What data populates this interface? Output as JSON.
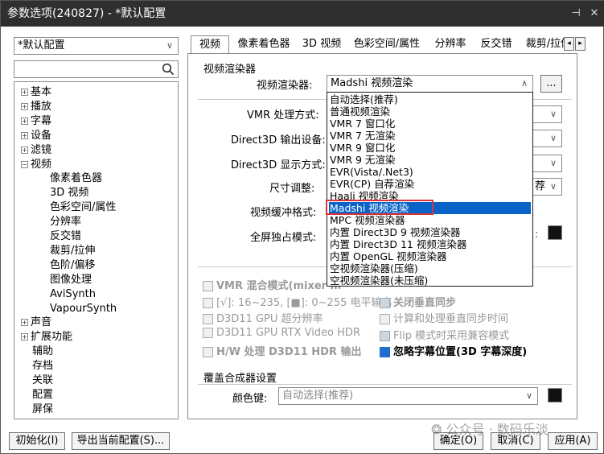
{
  "window": {
    "title": "参数选项(240827) - *默认配置",
    "pin_glyph": "⊣",
    "close_glyph": "✕"
  },
  "profile": {
    "value": "*默认配置"
  },
  "tree": {
    "items": [
      {
        "label": "基本",
        "expander": "+"
      },
      {
        "label": "播放",
        "expander": "+"
      },
      {
        "label": "字幕",
        "expander": "+"
      },
      {
        "label": "设备",
        "expander": "+"
      },
      {
        "label": "滤镜",
        "expander": "+"
      },
      {
        "label": "视频",
        "expander": "−"
      },
      {
        "label": "像素着色器"
      },
      {
        "label": "3D 视频"
      },
      {
        "label": "色彩空间/属性"
      },
      {
        "label": "分辨率"
      },
      {
        "label": "反交错"
      },
      {
        "label": "裁剪/拉伸"
      },
      {
        "label": "色阶/偏移"
      },
      {
        "label": "图像处理"
      },
      {
        "label": "AviSynth"
      },
      {
        "label": "VapourSynth"
      },
      {
        "label": "声音",
        "expander": "+"
      },
      {
        "label": "扩展功能",
        "expander": "+"
      },
      {
        "label": "辅助"
      },
      {
        "label": "存档"
      },
      {
        "label": "关联"
      },
      {
        "label": "配置"
      },
      {
        "label": "屏保"
      }
    ]
  },
  "tabs": [
    "视频",
    "像素着色器",
    "3D 视频",
    "色彩空间/属性",
    "分辨率",
    "反交错",
    "裁剪/拉伸"
  ],
  "tab_scroll": {
    "left": "◂",
    "right": "▸"
  },
  "renderer_group": {
    "title": "视频渲染器",
    "renderer_label": "视频渲染器:",
    "renderer_value": "Madshi 视频渲染",
    "more_button": "...",
    "vmr_mode_label": "VMR 处理方式:",
    "d3d_device_label": "Direct3D 输出设备:",
    "d3d_display_label": "Direct3D 显示方式:",
    "resize_label": "尺寸调整:",
    "resize_value_fragment": "荐",
    "buffer_label": "视频缓冲格式:",
    "fullscreen_label": "全屏独占模式:"
  },
  "dropdown": {
    "options": [
      "自动选择(推荐)",
      "普通视频渲染",
      "VMR 7 窗口化",
      "VMR 7 无渲染",
      "VMR 9 窗口化",
      "VMR 9 无渲染",
      "EVR(Vista/.Net3)",
      "EVR(CP) 自荐渲染",
      "Haali 视频渲染",
      "Madshi 视频渲染",
      "MPC 视频渲染器",
      "内置 Direct3D 9 视频渲染器",
      "内置 Direct3D 11 视频渲染器",
      "内置 OpenGL 视频渲染器",
      "空视频渲染器(压缩)",
      "空视频渲染器(未压缩)"
    ],
    "selected_index": 9
  },
  "options": {
    "vmr_mixer": "VMR 混合模式(mixer m",
    "levels": "[√]:  16~235, [■]:  0~255 电平输出",
    "d3d11_sr": "D3D11 GPU 超分辨率",
    "d3d11_hdr": "D3D11 GPU RTX Video HDR",
    "hw_hdr": "H/W 处理 D3D11 HDR 输出",
    "close_vsync": "关闭垂直同步",
    "compute_vsync": "计算和处理垂直同步时间",
    "flip_mode": "Flip 模式时采用兼容模式",
    "ignore_sub": "忽略字幕位置(3D 字幕深度)"
  },
  "overlay_group": {
    "title": "覆盖合成器设置",
    "color_key_label": "颜色键:",
    "color_key_value": "自动选择(推荐)"
  },
  "bottom": {
    "init_button": "初始化(I)",
    "export_button": "导出当前配置(S)...",
    "ok_button": "确定(O)",
    "cancel_button": "取消(C)",
    "apply_button": "应用(A)"
  },
  "watermark": "公众号 · 数码乐淡",
  "colors": {
    "selection": "#0a64c8",
    "highlight_box": "#d9343a",
    "accent_check": "#1e6fd0"
  }
}
